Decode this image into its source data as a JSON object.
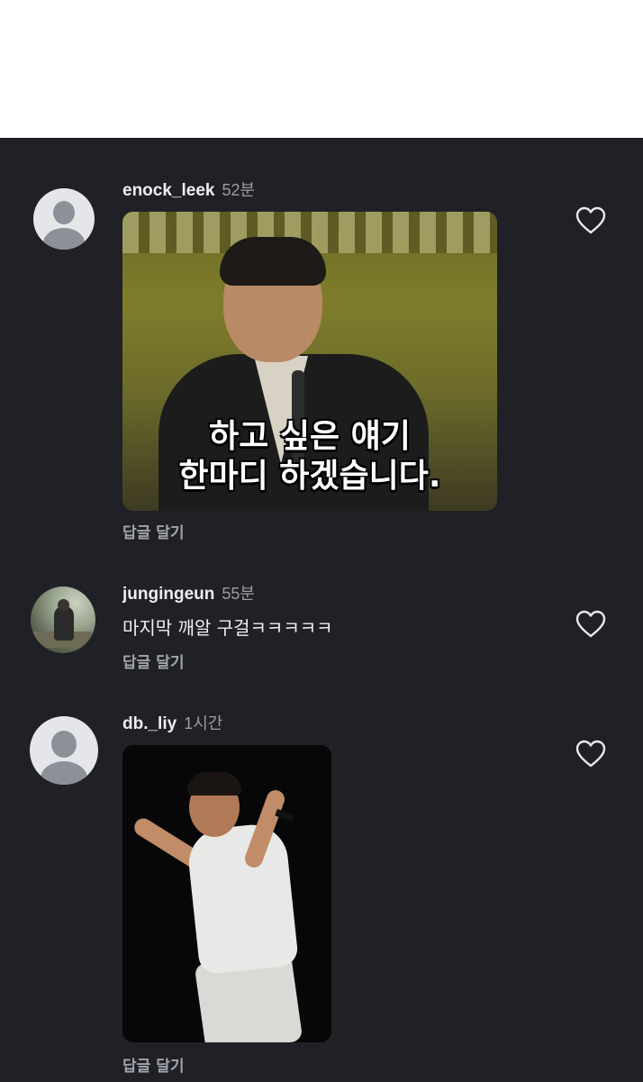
{
  "comments": [
    {
      "username": "enock_leek",
      "time": "52분",
      "media_caption_line1": "하고 싶은 얘기",
      "media_caption_line2": "한마디 하겠습니다.",
      "reply_label": "답글 달기",
      "avatar": "default-avatar-icon",
      "like_icon": "heart-outline-icon"
    },
    {
      "username": "jungingeun",
      "time": "55분",
      "text": "마지막 깨알 구걸ㅋㅋㅋㅋㅋ",
      "reply_label": "답글 달기",
      "avatar": "photo-avatar",
      "like_icon": "heart-outline-icon"
    },
    {
      "username": "db._liy",
      "time": "1시간",
      "reply_label": "답글 달기",
      "avatar": "default-avatar-icon",
      "like_icon": "heart-outline-icon"
    }
  ],
  "colors": {
    "panel_background": "#202126",
    "username": "#eceef2",
    "meta_gray": "#9a9ca3"
  }
}
